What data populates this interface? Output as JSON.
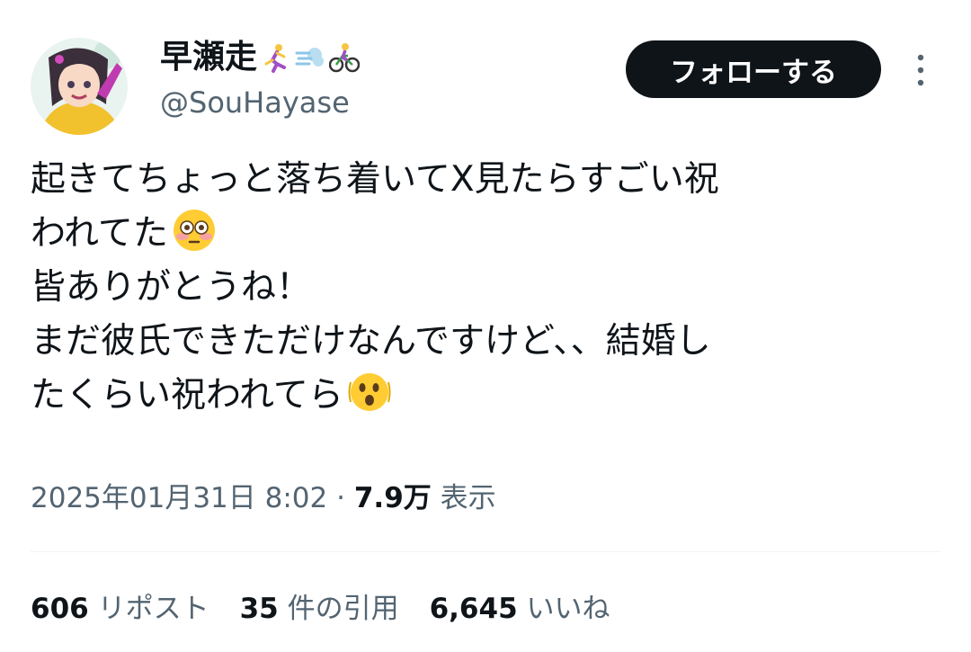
{
  "author": {
    "display_name": "早瀬走",
    "name_emojis": [
      "person-running-icon",
      "dash-icon",
      "woman-biking-icon"
    ],
    "handle": "@SouHayase"
  },
  "follow_button": {
    "label": "フォローする"
  },
  "tweet": {
    "lines": [
      "起きてちょっと落ち着いてX見たらすごい祝",
      "われてた",
      "皆ありがとうね！",
      "まだ彼氏できただけなんですけど、、結婚し",
      "たくらい祝われてら"
    ],
    "inline_emojis": [
      "flushed-face-icon",
      "shaking-face-icon"
    ]
  },
  "meta": {
    "timestamp": "2025年01月31日 8:02",
    "separator": "·",
    "views": "7.9万",
    "views_label": "表示"
  },
  "stats": {
    "reposts_count": "606",
    "reposts_label": "リポスト",
    "quotes_count": "35",
    "quotes_label": "件の引用",
    "likes_count": "6,645",
    "likes_label": "いいね"
  },
  "colors": {
    "text_primary": "#0f1419",
    "text_secondary": "#536471",
    "button_bg": "#0f1419",
    "divider": "#eff3f4"
  }
}
